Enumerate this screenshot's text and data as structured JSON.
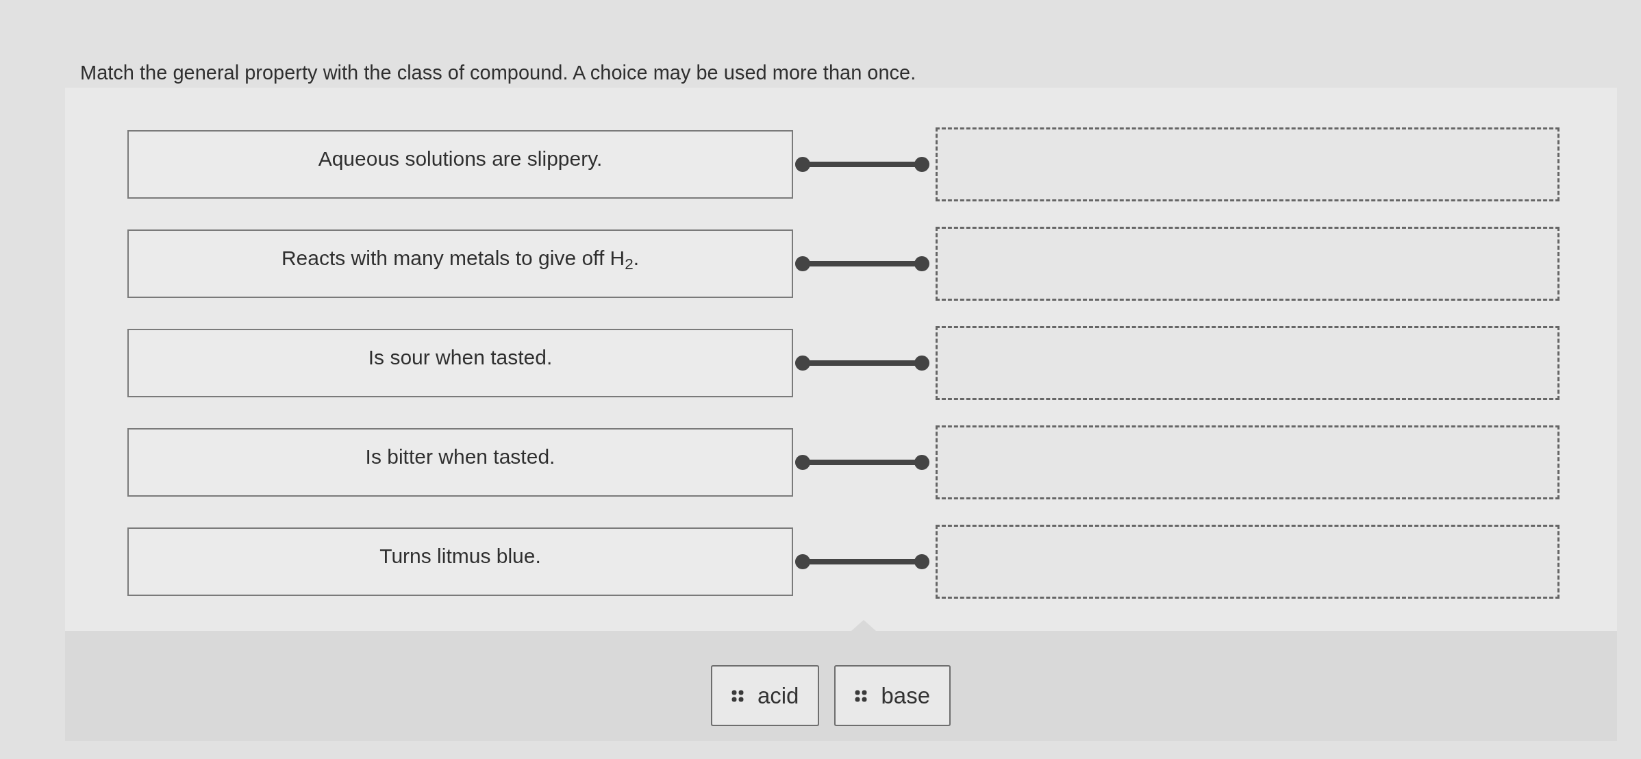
{
  "prompt": "Match the general property with the class of compound. A choice may be used more than once.",
  "statements": [
    {
      "text": "Aqueous solutions are slippery."
    },
    {
      "text": "Reacts with many metals to give off H$_{2}$."
    },
    {
      "text": "Is sour when tasted."
    },
    {
      "text": "Is bitter when tasted."
    },
    {
      "text": "Turns litmus blue."
    }
  ],
  "choices": [
    {
      "label": "acid"
    },
    {
      "label": "base"
    }
  ]
}
